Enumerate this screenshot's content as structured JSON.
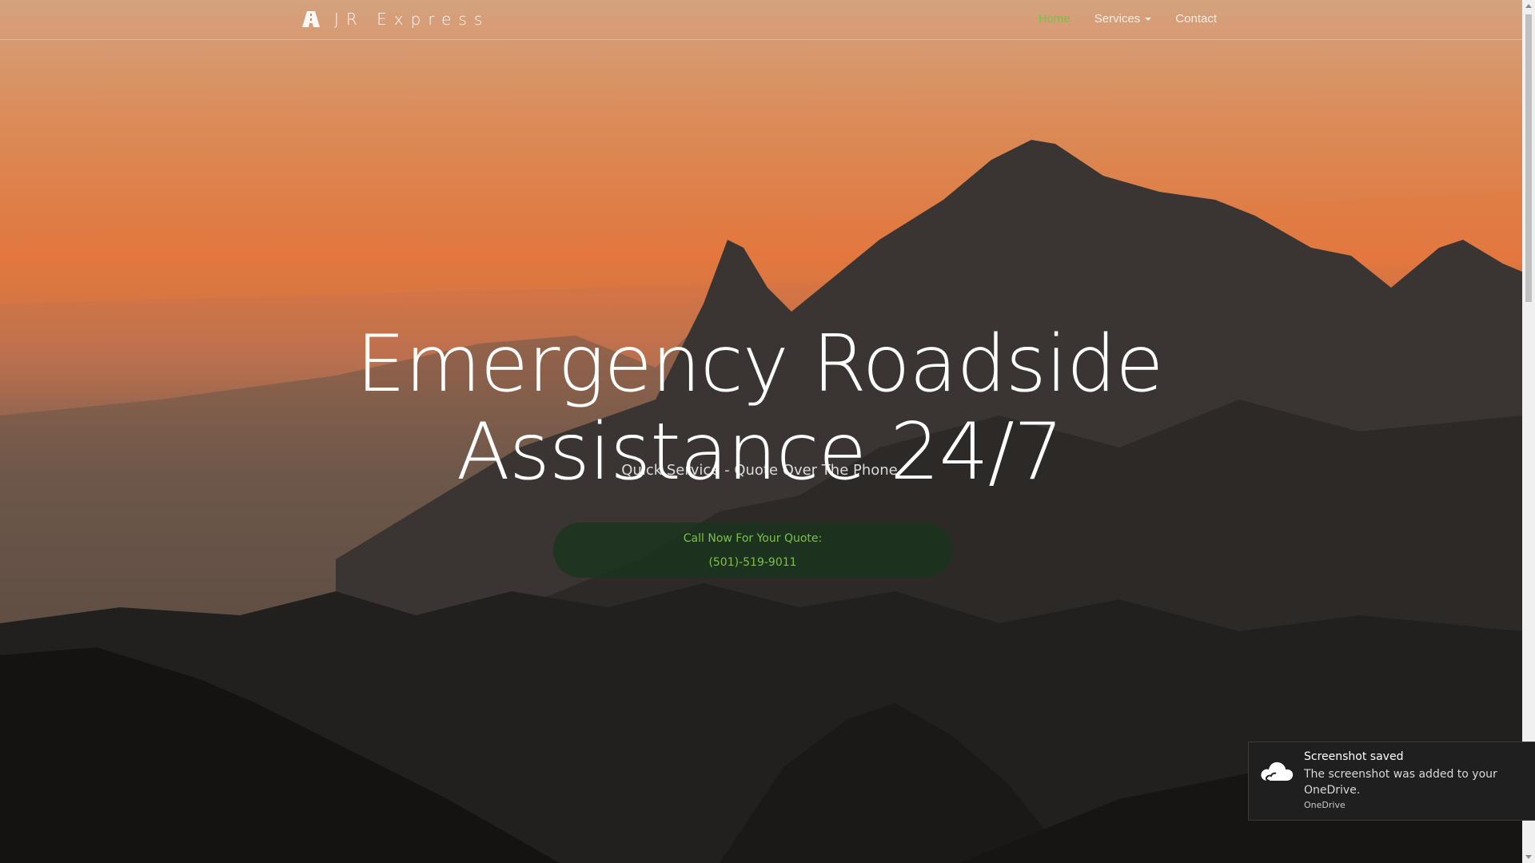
{
  "brand": {
    "name": "JR Express",
    "icon": "road-icon"
  },
  "nav": {
    "items": [
      {
        "label": "Home",
        "active": true
      },
      {
        "label": "Services",
        "dropdown": true
      },
      {
        "label": "Contact"
      }
    ],
    "active_color": "#7cc04a"
  },
  "hero": {
    "title": "Emergency Roadside Assistance 24/7",
    "subtitle": "Quick Service - Quote Over The Phone",
    "cta_line1": "Call Now For Your Quote:",
    "cta_line2": "(501)-519-9011"
  },
  "toast": {
    "icon": "onedrive-cloud-icon",
    "title": "Screenshot saved",
    "body": "The screenshot was added to your OneDrive.",
    "source": "OneDrive"
  },
  "colors": {
    "accent_green": "#7cc04a",
    "cta_background": "#18341c",
    "toast_background": "#1f1f1f"
  }
}
